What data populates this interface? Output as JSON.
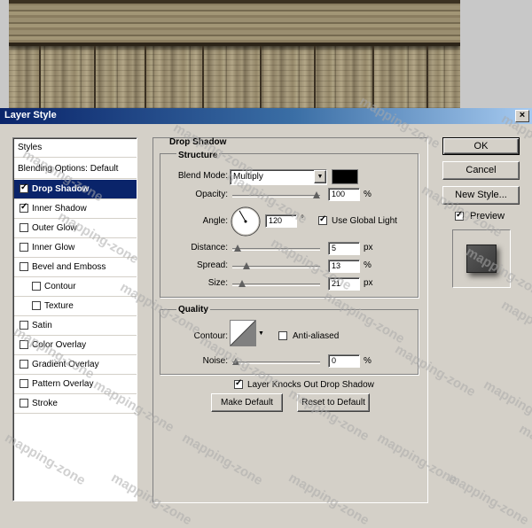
{
  "window": {
    "title": "Layer Style",
    "close": "×"
  },
  "styles_panel": {
    "header": "Styles",
    "blending": "Blending Options: Default",
    "items": [
      {
        "label": "Drop Shadow",
        "checked": true,
        "selected": true,
        "indent": false
      },
      {
        "label": "Inner Shadow",
        "checked": true,
        "selected": false,
        "indent": false
      },
      {
        "label": "Outer Glow",
        "checked": false,
        "selected": false,
        "indent": false
      },
      {
        "label": "Inner Glow",
        "checked": false,
        "selected": false,
        "indent": false
      },
      {
        "label": "Bevel and Emboss",
        "checked": false,
        "selected": false,
        "indent": false
      },
      {
        "label": "Contour",
        "checked": false,
        "selected": false,
        "indent": true
      },
      {
        "label": "Texture",
        "checked": false,
        "selected": false,
        "indent": true
      },
      {
        "label": "Satin",
        "checked": false,
        "selected": false,
        "indent": false
      },
      {
        "label": "Color Overlay",
        "checked": false,
        "selected": false,
        "indent": false
      },
      {
        "label": "Gradient Overlay",
        "checked": false,
        "selected": false,
        "indent": false
      },
      {
        "label": "Pattern Overlay",
        "checked": false,
        "selected": false,
        "indent": false
      },
      {
        "label": "Stroke",
        "checked": false,
        "selected": false,
        "indent": false
      }
    ]
  },
  "drop_shadow": {
    "title": "Drop Shadow",
    "structure": {
      "title": "Structure",
      "blend_mode_label": "Blend Mode:",
      "blend_mode_value": "Multiply",
      "shadow_color": "#000000",
      "opacity_label": "Opacity:",
      "opacity_value": "100",
      "opacity_unit": "%",
      "opacity_level": 1.0,
      "angle_label": "Angle:",
      "angle_value": "120",
      "angle_unit": "°",
      "use_global_light_label": "Use Global Light",
      "use_global_light": true,
      "distance_label": "Distance:",
      "distance_value": "5",
      "distance_unit": "px",
      "distance_level": 0.02,
      "spread_label": "Spread:",
      "spread_value": "13",
      "spread_unit": "%",
      "spread_level": 0.13,
      "size_label": "Size:",
      "size_value": "21",
      "size_unit": "px",
      "size_level": 0.08
    },
    "quality": {
      "title": "Quality",
      "contour_label": "Contour:",
      "anti_aliased_label": "Anti-aliased",
      "anti_aliased": false,
      "noise_label": "Noise:",
      "noise_value": "0",
      "noise_unit": "%",
      "noise_level": 0
    },
    "knocks_out_label": "Layer Knocks Out Drop Shadow",
    "knocks_out": true,
    "make_default": "Make Default",
    "reset_default": "Reset to Default"
  },
  "actions": {
    "ok": "OK",
    "cancel": "Cancel",
    "new_style": "New Style...",
    "preview_label": "Preview",
    "preview": true
  },
  "watermark": "mapping-zone"
}
